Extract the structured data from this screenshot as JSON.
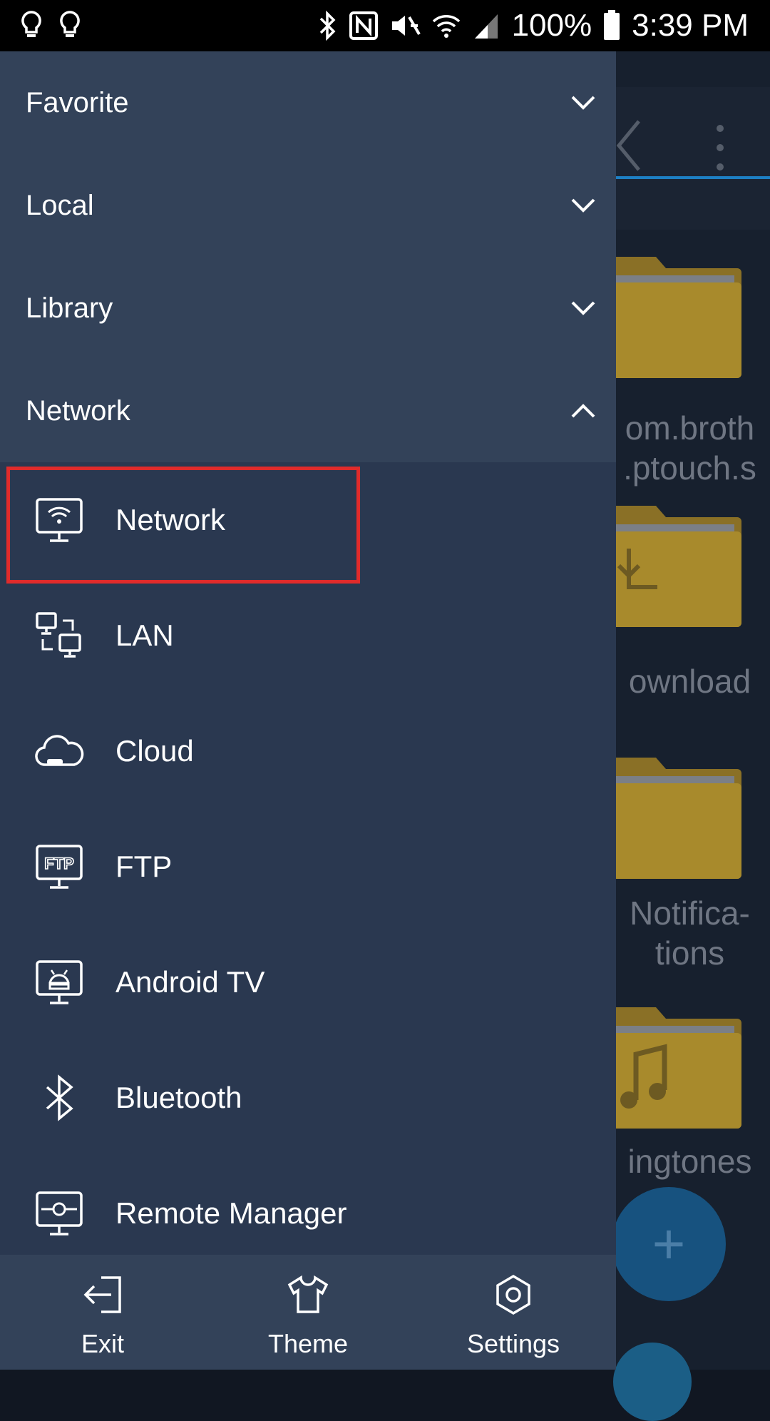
{
  "status_bar": {
    "battery": "100%",
    "time": "3:39 PM"
  },
  "background": {
    "folders": [
      {
        "label": "om.broth\n.ptouch.s"
      },
      {
        "label": "ownload"
      },
      {
        "label": "Notifica-\ntions"
      },
      {
        "label": "ingtones"
      }
    ]
  },
  "drawer": {
    "sections": [
      {
        "title": "Favorite",
        "expanded": false
      },
      {
        "title": "Local",
        "expanded": false
      },
      {
        "title": "Library",
        "expanded": false
      },
      {
        "title": "Network",
        "expanded": true
      }
    ],
    "network_items": [
      {
        "label": "Network",
        "icon": "network-wifi-monitor-icon",
        "selected": true
      },
      {
        "label": "LAN",
        "icon": "lan-icon"
      },
      {
        "label": "Cloud",
        "icon": "cloud-icon"
      },
      {
        "label": "FTP",
        "icon": "ftp-icon"
      },
      {
        "label": "Android TV",
        "icon": "android-tv-icon"
      },
      {
        "label": "Bluetooth",
        "icon": "bluetooth-icon"
      },
      {
        "label": "Remote Manager",
        "icon": "remote-manager-icon"
      }
    ],
    "bottom": {
      "exit": "Exit",
      "theme": "Theme",
      "settings": "Settings"
    }
  },
  "colors": {
    "drawer_bg": "#2a3850",
    "header_bg": "#334259",
    "highlight": "#e02b2b",
    "folder": "#a88a2c",
    "accent": "#1d7fc4"
  }
}
